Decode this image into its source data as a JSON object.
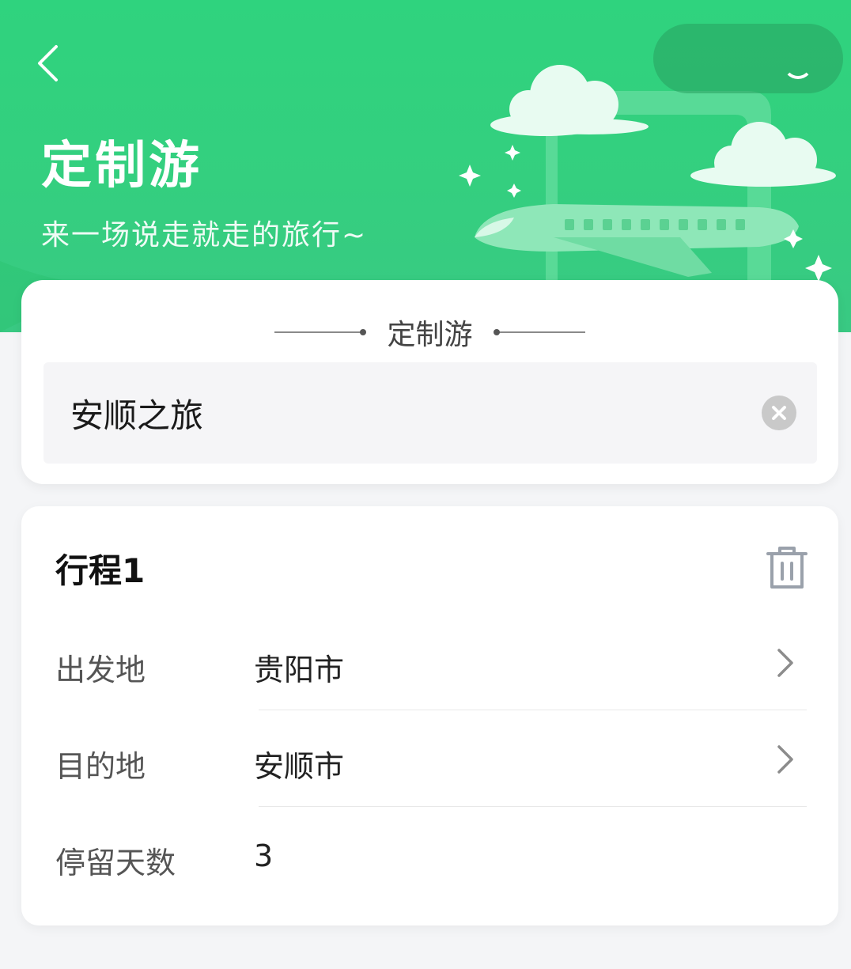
{
  "header": {
    "title": "定制游",
    "subtitle": "来一场说走就走的旅行~",
    "back_icon": "chevron-left-icon",
    "colors": {
      "brand_green": "#33d17f",
      "light_green": "#d9f7e6"
    }
  },
  "name_section": {
    "heading": "定制游",
    "trip_name_value": "安顺之旅",
    "clear_icon": "clear-circle-icon"
  },
  "itinerary": {
    "title": "行程1",
    "delete_icon": "trash-icon",
    "rows": [
      {
        "label": "出发地",
        "value": "贵阳市",
        "icon": "chevron-right-icon"
      },
      {
        "label": "目的地",
        "value": "安顺市",
        "icon": "chevron-right-icon"
      },
      {
        "label": "停留天数",
        "value": "3"
      }
    ]
  }
}
